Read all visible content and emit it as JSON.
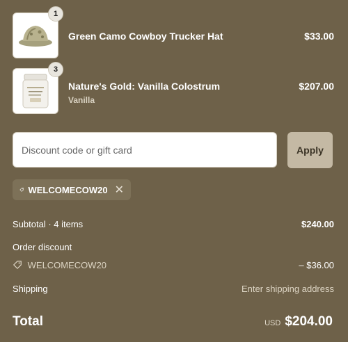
{
  "cart": {
    "items": [
      {
        "name": "Green Camo Cowboy Trucker Hat",
        "variant": "",
        "price": "$33.00",
        "quantity": "1",
        "icon": "hat-thumbnail"
      },
      {
        "name": "Nature's Gold: Vanilla Colostrum",
        "variant": "Vanilla",
        "price": "$207.00",
        "quantity": "3",
        "icon": "jar-thumbnail"
      }
    ]
  },
  "discount": {
    "placeholder": "Discount code or gift card",
    "apply_label": "Apply",
    "applied_code": "WELCOMECOW20",
    "tag_icon": "tag-icon",
    "remove_icon": "close-icon"
  },
  "summary": {
    "subtotal_label": "Subtotal · 4 items",
    "subtotal_value": "$240.00",
    "order_discount_label": "Order discount",
    "discount_code": "WELCOMECOW20",
    "discount_value": "– $36.00",
    "shipping_label": "Shipping",
    "shipping_value": "Enter shipping address",
    "total_label": "Total",
    "currency": "USD",
    "total_value": "$204.00"
  },
  "colors": {
    "background": "#6e6149",
    "apply_button": "#c4b9a4",
    "chip": "#7d7158"
  }
}
